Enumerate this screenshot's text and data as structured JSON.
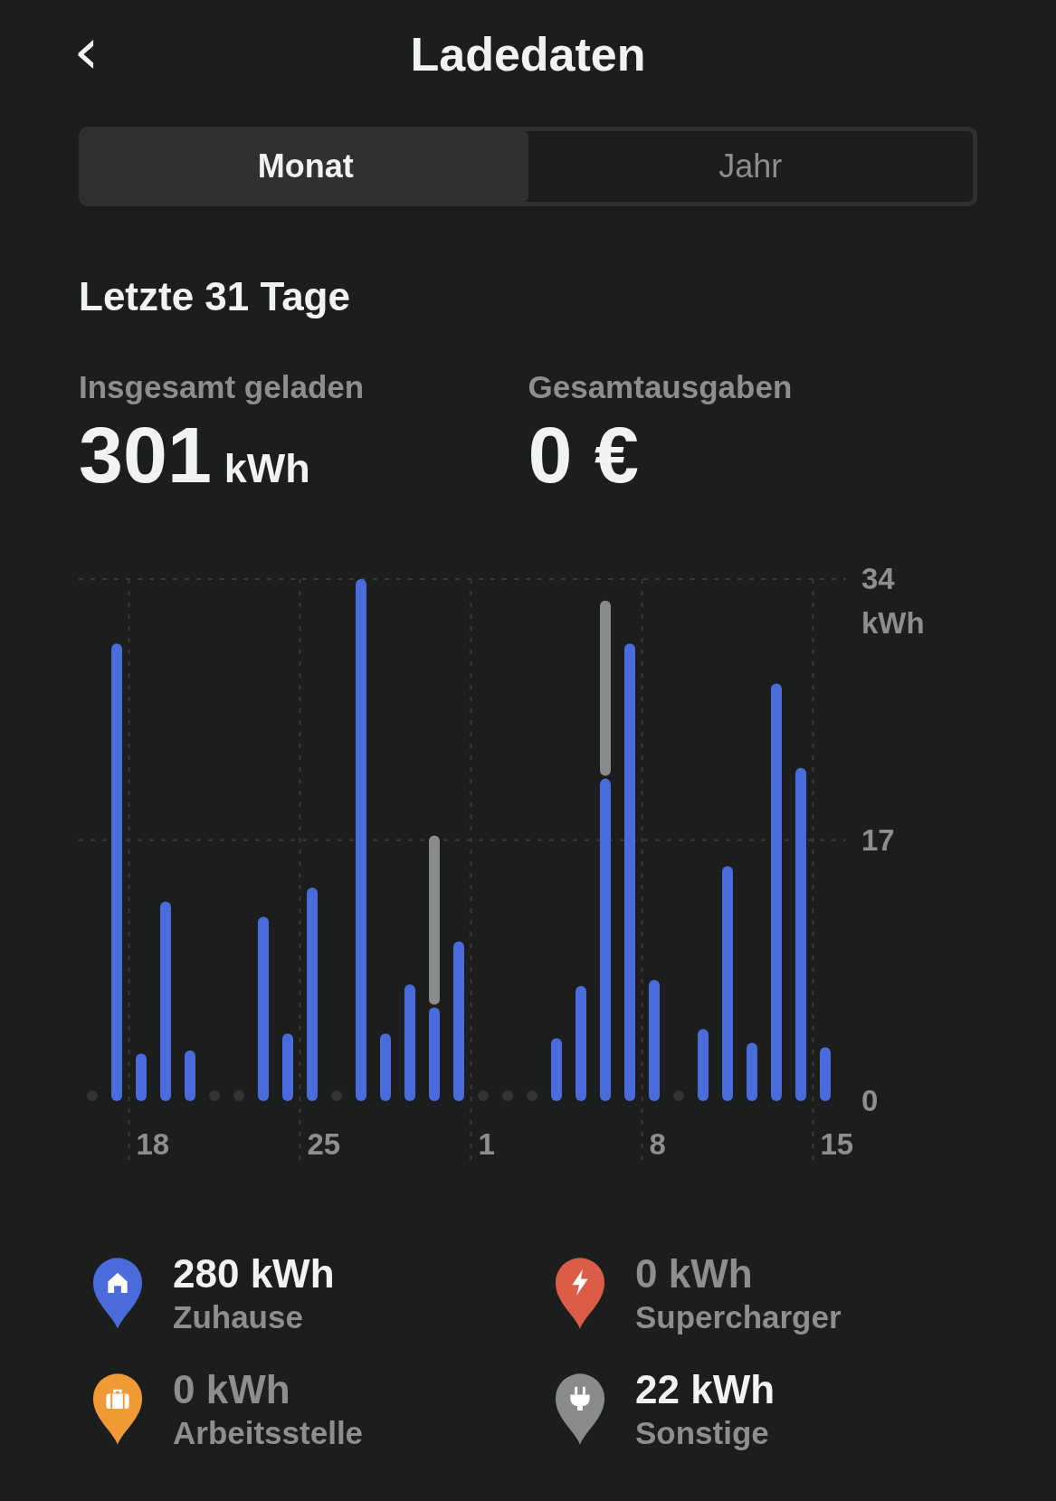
{
  "header": {
    "back": "‹",
    "title": "Ladedaten"
  },
  "tabs": [
    {
      "label": "Monat",
      "selected": true
    },
    {
      "label": "Jahr",
      "selected": false
    }
  ],
  "period": "Letzte 31 Tage",
  "stats": [
    {
      "label": "Insgesamt geladen",
      "value": "301",
      "unit": "kWh"
    },
    {
      "label": "Gesamtausgaben",
      "value": "0 €"
    }
  ],
  "chart_data": {
    "type": "bar",
    "stacked": true,
    "ylabel": "kWh",
    "grid": true,
    "categories": [
      null,
      null,
      "18",
      null,
      null,
      null,
      null,
      null,
      null,
      "25",
      null,
      null,
      null,
      null,
      null,
      null,
      "1",
      null,
      null,
      null,
      null,
      null,
      null,
      "8",
      null,
      null,
      null,
      null,
      null,
      null,
      "15"
    ],
    "series": [
      {
        "color": "#4a6bdc",
        "values": [
          0,
          29.8,
          3.1,
          13.0,
          3.3,
          0,
          0,
          12.0,
          4.4,
          13.9,
          0,
          34,
          4.4,
          7.6,
          6.1,
          10.4,
          0,
          0,
          0,
          4.1,
          7.5,
          21.0,
          29.8,
          7.9,
          0,
          4.7,
          15.3,
          3.8,
          27.2,
          21.7,
          3.5
        ]
      },
      {
        "color": "#8a8a8a",
        "values": [
          0,
          0,
          0,
          0,
          0,
          0,
          0,
          0,
          0,
          0,
          0,
          0,
          0,
          0,
          11.2,
          0,
          0,
          0,
          0,
          0,
          0,
          11.6,
          0,
          0,
          0,
          0,
          0,
          0,
          0,
          0,
          0
        ]
      }
    ],
    "ylim": [
      0,
      34
    ],
    "yticks": [
      0,
      17,
      34
    ]
  },
  "legend": [
    {
      "kind": "home",
      "color": "#4a6bdc",
      "value": "280 kWh",
      "label": "Zuhause",
      "active": true
    },
    {
      "kind": "bolt",
      "color": "#db5d47",
      "value": "0 kWh",
      "label": "Supercharger",
      "active": false
    },
    {
      "kind": "work",
      "color": "#f09a36",
      "value": "0 kWh",
      "label": "Arbeitsstelle",
      "active": false
    },
    {
      "kind": "plug",
      "color": "#8a8a8a",
      "value": "22 kWh",
      "label": "Sonstige",
      "active": true
    }
  ]
}
